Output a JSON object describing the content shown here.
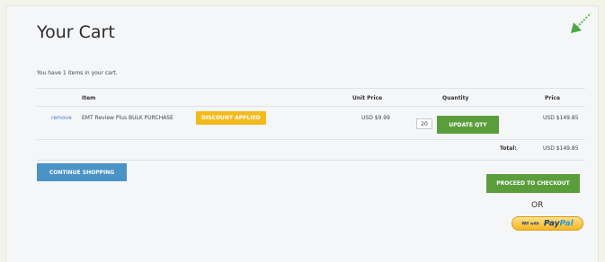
{
  "cart": {
    "title": "Your Cart",
    "summary": "You have 1 items in your cart."
  },
  "table": {
    "headers": {
      "item": "Item",
      "unit_price": "Unit Price",
      "quantity": "Quantity",
      "price": "Price"
    },
    "rows": [
      {
        "remove_label": "remove",
        "item_name": "EMT Review Plus BULK PURCHASE",
        "badge": "DISCOUNT APPLIED",
        "unit_price": "USD $9.99",
        "quantity": "20",
        "update_label": "UPDATE QTY",
        "price": "USD $149.85"
      }
    ],
    "total_label": "Total:",
    "total_value": "USD $149.85"
  },
  "actions": {
    "continue_shopping": "CONTINUE SHOPPING",
    "proceed_checkout": "PROCEED TO CHECKOUT",
    "or_label": "OR",
    "paypal": {
      "prefix": "PAY with",
      "pay": "Pay",
      "pal": "Pal"
    }
  },
  "colors": {
    "accent_green": "#5a9e3c",
    "accent_blue": "#4a93c7",
    "badge_yellow": "#f3ba1c",
    "link_blue": "#3a85c0"
  },
  "icons": {
    "corner": "diagonal-arrow-icon"
  }
}
